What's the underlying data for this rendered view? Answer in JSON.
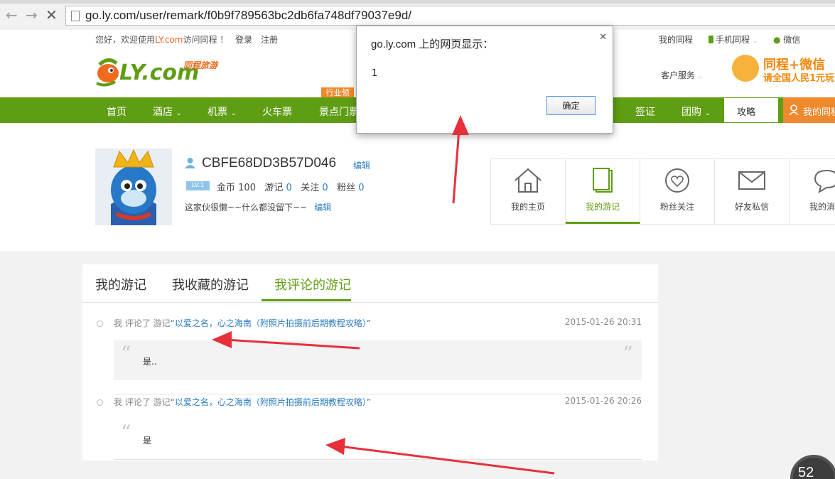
{
  "browser": {
    "url": "go.ly.com/user/remark/f0b9f789563bc2db6fa748df79037e9d/"
  },
  "topbar": {
    "welcome_pre": "您好，欢迎使用",
    "welcome_brand": "LY.com",
    "welcome_post": "访问同程 ！",
    "login": "登录",
    "register": "注册",
    "my_tongcheng": "我的同程",
    "mobile": "手机同程",
    "weixin": "微信"
  },
  "header": {
    "logo_text": "LY.com",
    "logo_sub": "同程旅游",
    "service": "客户服务",
    "promo_line1": "同程+微信",
    "promo_line2": "请全国人民1元玩"
  },
  "nav": {
    "badge": "行业领",
    "items": [
      "首页",
      "酒店",
      "机票",
      "火车票",
      "景点门票",
      "签证",
      "团购"
    ],
    "search": "攻略",
    "my": "我的同程"
  },
  "profile": {
    "username": "CBFE68DD3B57D046",
    "edit": "编辑",
    "level": "LV.1",
    "coins_label": "金币",
    "coins": "100",
    "trips_label": "游记",
    "trips": "0",
    "follow_label": "关注",
    "follow": "0",
    "fans_label": "粉丝",
    "fans": "0",
    "signature": "这家伙很懒~~什么都没留下~~",
    "sig_edit": "编辑"
  },
  "tiles": [
    {
      "label": "我的主页",
      "icon": "home-icon"
    },
    {
      "label": "我的游记",
      "icon": "notebook-icon"
    },
    {
      "label": "粉丝关注",
      "icon": "heart-icon"
    },
    {
      "label": "好友私信",
      "icon": "mail-icon"
    },
    {
      "label": "我的消息",
      "icon": "message-icon"
    }
  ],
  "tabs": [
    "我的游记",
    "我收藏的游记",
    "我评论的游记"
  ],
  "comments": [
    {
      "prefix": "我 评论了 游记",
      "title": "“以爱之名，心之海南（附照片拍摄前后期教程攻略）”",
      "time": "2015-01-26 20:31",
      "text": "是.."
    },
    {
      "prefix": "我 评论了 游记",
      "title": "“以爱之名，心之海南（附照片拍摄前后期教程攻略）”",
      "time": "2015-01-26 20:26",
      "text": "是"
    }
  ],
  "dialog": {
    "title": "go.ly.com 上的网页显示：",
    "message": "1",
    "ok": "确定"
  },
  "speed": {
    "value": "52"
  }
}
